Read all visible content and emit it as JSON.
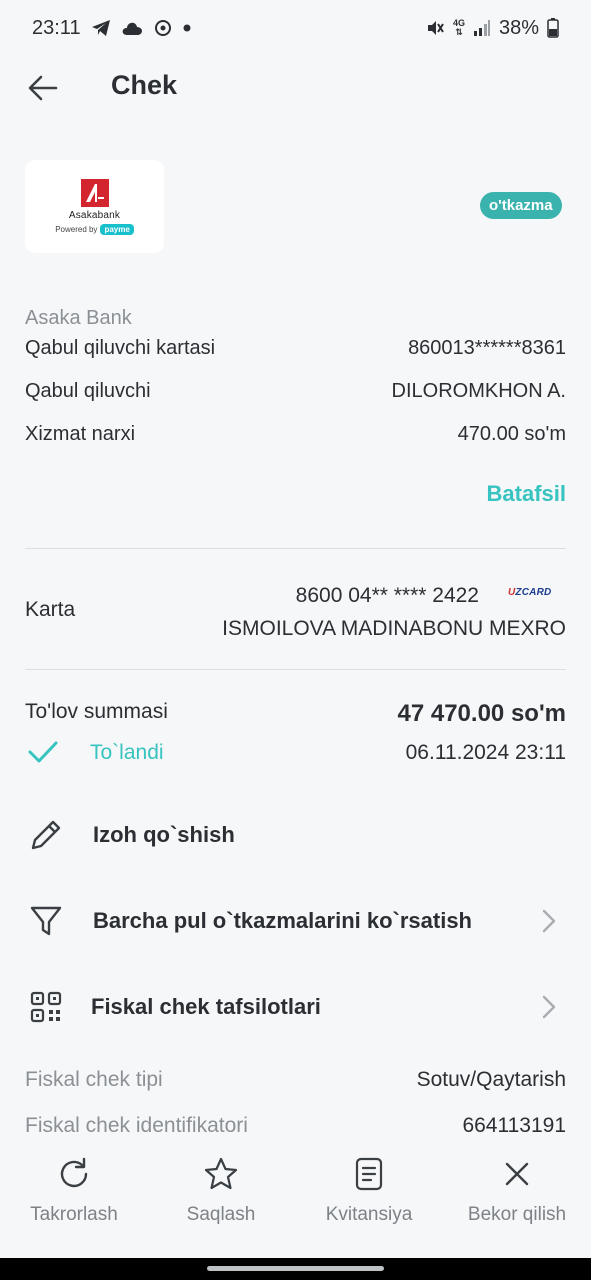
{
  "status_bar": {
    "time": "23:11",
    "battery": "38%",
    "network": "4G"
  },
  "header": {
    "title": "Chek",
    "back_icon": "arrow-left-icon"
  },
  "merchant": {
    "logo_name": "Asakabank",
    "powered_by": "Powered by",
    "powered_brand": "payme",
    "type_badge": "o'tkazma",
    "bank_name": "Asaka Bank"
  },
  "details": [
    {
      "label": "Qabul qiluvchi kartasi",
      "value": "860013******8361"
    },
    {
      "label": "Qabul qiluvchi",
      "value": "DILOROMKHON A."
    },
    {
      "label": "Xizmat narxi",
      "value": "470.00 so'm"
    }
  ],
  "details_link": "Batafsil",
  "card": {
    "label": "Karta",
    "number": "8600 04** **** 2422",
    "brand_u": "U",
    "brand_rest": "ZCARD",
    "holder": "ISMOILOVA MADINABONU MEXRO"
  },
  "payment": {
    "amount_label": "To'lov summasi",
    "amount_value": "47 470.00 so'm",
    "status": "To`landi",
    "datetime": "06.11.2024 23:11"
  },
  "actions": [
    {
      "label": "Izoh qo`shish",
      "icon": "pencil-icon"
    },
    {
      "label": "Barcha pul o`tkazmalarini ko`rsatish",
      "icon": "filter-icon"
    },
    {
      "label": "Fiskal chek tafsilotlari",
      "icon": "qr-code-icon"
    }
  ],
  "fiscal": [
    {
      "label": "Fiskal chek tipi",
      "value": "Sotuv/Qaytarish"
    },
    {
      "label": "Fiskal chek identifikatori",
      "value": "664113191"
    }
  ],
  "bottom_nav": [
    {
      "label": "Takrorlash",
      "icon": "refresh-icon"
    },
    {
      "label": "Saqlash",
      "icon": "star-icon"
    },
    {
      "label": "Kvitansiya",
      "icon": "receipt-icon"
    },
    {
      "label": "Bekor qilish",
      "icon": "close-icon"
    }
  ],
  "colors": {
    "accent": "#37c3bf",
    "badge": "#3ab3ae",
    "background": "#f6f7f9",
    "text": "#2b2f33",
    "muted": "#8b9095"
  }
}
